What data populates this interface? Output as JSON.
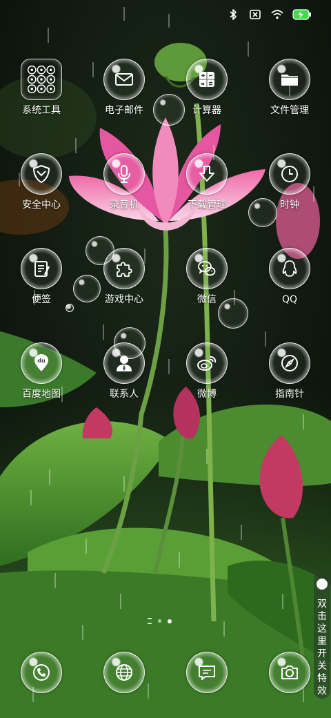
{
  "status_bar": {
    "icons": [
      "bluetooth-icon",
      "sim-none-icon",
      "wifi-icon",
      "battery-charging-icon"
    ],
    "battery_color": "#3ddc4a"
  },
  "apps": [
    [
      {
        "label": "系统工具",
        "icon": "tools-folder-icon"
      },
      {
        "label": "电子邮件",
        "icon": "mail-icon"
      },
      {
        "label": "计算器",
        "icon": "calculator-icon"
      },
      {
        "label": "文件管理",
        "icon": "folder-icon"
      }
    ],
    [
      {
        "label": "安全中心",
        "icon": "shield-icon"
      },
      {
        "label": "录音机",
        "icon": "microphone-icon"
      },
      {
        "label": "下载管理",
        "icon": "download-icon"
      },
      {
        "label": "时钟",
        "icon": "clock-icon"
      }
    ],
    [
      {
        "label": "便签",
        "icon": "notepad-icon"
      },
      {
        "label": "游戏中心",
        "icon": "puzzle-icon"
      },
      {
        "label": "微信",
        "icon": "wechat-icon"
      },
      {
        "label": "QQ",
        "icon": "qq-penguin-icon"
      }
    ],
    [
      {
        "label": "百度地图",
        "icon": "map-pin-icon"
      },
      {
        "label": "联系人",
        "icon": "contact-person-icon"
      },
      {
        "label": "微博",
        "icon": "weibo-icon"
      },
      {
        "label": "指南针",
        "icon": "compass-icon"
      }
    ]
  ],
  "dock": [
    {
      "icon": "phone-icon"
    },
    {
      "icon": "browser-globe-icon"
    },
    {
      "icon": "message-icon"
    },
    {
      "icon": "camera-icon"
    }
  ],
  "page_indicator": {
    "pages": 2,
    "current": 2
  },
  "effect_toggle": {
    "label": "双击这里开关特效"
  },
  "colors": {
    "accent_green": "#3ddc4a",
    "lotus_pink": "#e05a9a"
  }
}
